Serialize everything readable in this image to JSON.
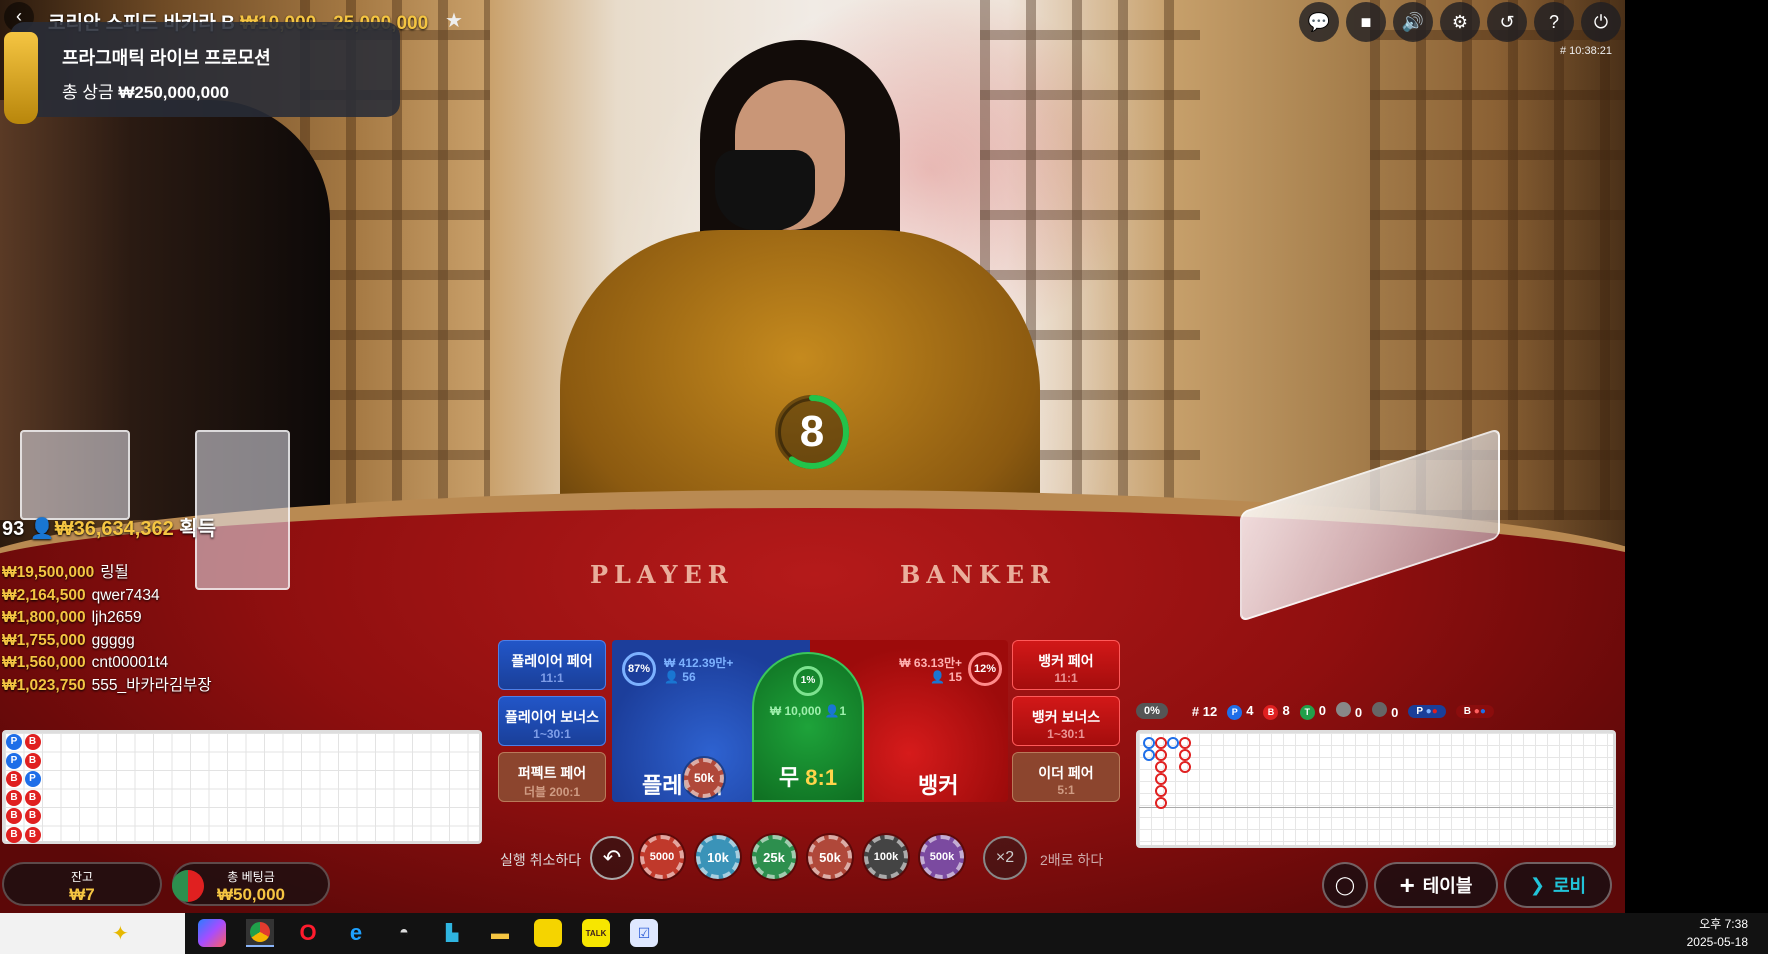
{
  "header": {
    "game_title": "코리안 스피드 바카라 B",
    "bet_limits": "₩10,000 - 25,000,000",
    "round_id": "# 10:38:21"
  },
  "promo": {
    "title": "프라그매틱 라이브 프로모션",
    "prize_label": "총 상금",
    "prize_amount": "₩250,000,000"
  },
  "top_icons": [
    "chat-icon",
    "video-icon",
    "volume-icon",
    "settings-icon",
    "history-icon",
    "help-icon",
    "lobby-exit-icon"
  ],
  "timer": {
    "value": "8",
    "fraction_remaining": 0.6
  },
  "winners": {
    "count": "93",
    "total": "₩36,634,362",
    "suffix": "획득",
    "list": [
      {
        "amount": "₩19,500,000",
        "name": "링될"
      },
      {
        "amount": "₩2,164,500",
        "name": "qwer7434"
      },
      {
        "amount": "₩1,800,000",
        "name": "ljh2659"
      },
      {
        "amount": "₩1,755,000",
        "name": "ggggg"
      },
      {
        "amount": "₩1,560,000",
        "name": "cnt00001t4"
      },
      {
        "amount": "₩1,023,750",
        "name": "555_바카라김부장"
      }
    ]
  },
  "bead_road_left": {
    "columns": [
      [
        "P",
        "P",
        "B",
        "B",
        "B",
        "B"
      ],
      [
        "B",
        "B",
        "P",
        "B",
        "B",
        "B"
      ]
    ]
  },
  "bets": {
    "player_pair": {
      "label": "플레이어 페어",
      "odds": "11:1"
    },
    "player_bonus": {
      "label": "플레이어 보너스",
      "odds": "1~30:1"
    },
    "perfect_pair": {
      "label": "퍼펙트 페어",
      "odds": "더블 200:1"
    },
    "banker_pair": {
      "label": "뱅커 페어",
      "odds": "11:1"
    },
    "banker_bonus": {
      "label": "뱅커 보너스",
      "odds": "1~30:1"
    },
    "either_pair": {
      "label": "이더 페어",
      "odds": "5:1"
    },
    "player": {
      "label": "플레이어",
      "pct": "87%",
      "amount": "₩ 412.39만+",
      "players": "56",
      "chip": "50k"
    },
    "tie": {
      "label": "무",
      "odds": "8:1",
      "pct": "1%",
      "amount": "₩ 10,000",
      "players": "1"
    },
    "banker": {
      "label": "뱅커",
      "pct": "12%",
      "amount": "₩ 63.13만+",
      "players": "15"
    }
  },
  "controls": {
    "cancel_label": "실행 취소하다",
    "double_label": "2배로 하다",
    "double_symbol": "×2",
    "chips": [
      {
        "value": "5000",
        "color": "#c0392b"
      },
      {
        "value": "10k",
        "color": "#3a93b8"
      },
      {
        "value": "25k",
        "color": "#2d8f4e"
      },
      {
        "value": "50k",
        "color": "#b0483a"
      },
      {
        "value": "100k",
        "color": "#444444"
      },
      {
        "value": "500k",
        "color": "#7b4aa0"
      }
    ]
  },
  "scoreboard": {
    "progress": "0%",
    "round": "# 12",
    "player_count": "4",
    "banker_count": "8",
    "tie_count": "0",
    "player_pair_count": "0",
    "banker_pair_count": "0",
    "p_predict": "P",
    "b_predict": "B"
  },
  "wallet": {
    "balance_label": "잔고",
    "balance": "₩7",
    "total_bet_label": "총 베팅금",
    "total_bet": "₩50,000"
  },
  "nav": {
    "table_label": "테이블",
    "lobby_label": "로비"
  },
  "table_felt": {
    "player_text": "PLAYER",
    "banker_text": "BANKER"
  },
  "taskbar": {
    "time": "오후 7:38",
    "date": "2025-05-18"
  }
}
